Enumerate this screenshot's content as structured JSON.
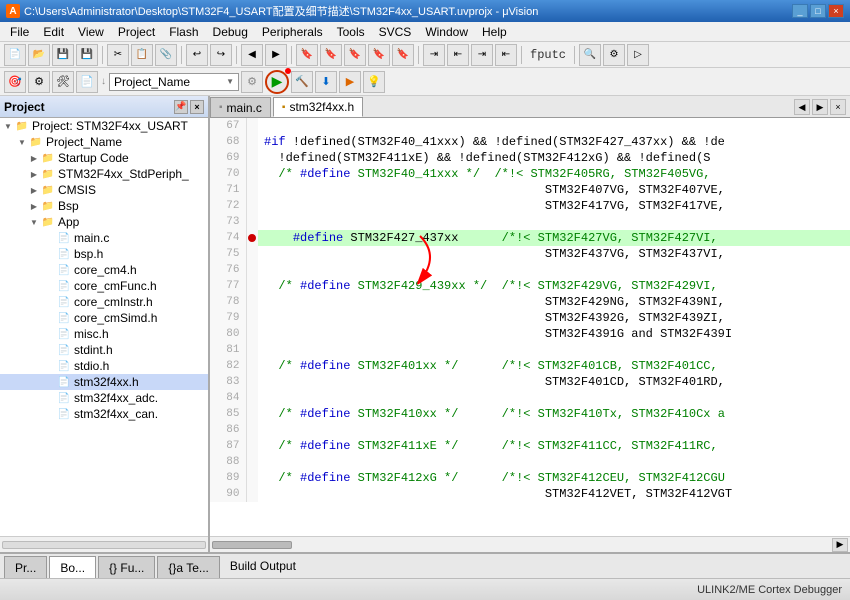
{
  "titleBar": {
    "icon": "A",
    "title": "C:\\Users\\Administrator\\Desktop\\STM32F4_USART配置及细节描述\\STM32F4xx_USART.uvprojx - μVision",
    "controls": [
      "_",
      "□",
      "×"
    ]
  },
  "menuBar": {
    "items": [
      "File",
      "Edit",
      "View",
      "Project",
      "Flash",
      "Debug",
      "Peripherals",
      "Tools",
      "SVCS",
      "Window",
      "Help"
    ]
  },
  "toolbar2": {
    "projectName": "Project_Name"
  },
  "sidebar": {
    "title": "Project",
    "root": "Project: STM32F4xx_USART",
    "projectName": "Project_Name",
    "items": [
      {
        "label": "Startup Code",
        "type": "folder",
        "level": 2
      },
      {
        "label": "STM32F4xx_StdPeriph_",
        "type": "folder",
        "level": 2
      },
      {
        "label": "CMSIS",
        "type": "folder",
        "level": 2
      },
      {
        "label": "Bsp",
        "type": "folder",
        "level": 2
      },
      {
        "label": "App",
        "type": "folder",
        "level": 2
      },
      {
        "label": "main.c",
        "type": "file",
        "level": 3
      },
      {
        "label": "bsp.h",
        "type": "file",
        "level": 4
      },
      {
        "label": "core_cm4.h",
        "type": "file",
        "level": 4
      },
      {
        "label": "core_cmFunc.h",
        "type": "file",
        "level": 4
      },
      {
        "label": "core_cmInstr.h",
        "type": "file",
        "level": 4
      },
      {
        "label": "core_cmSimd.h",
        "type": "file",
        "level": 4
      },
      {
        "label": "misc.h",
        "type": "file",
        "level": 4
      },
      {
        "label": "stdint.h",
        "type": "file",
        "level": 4
      },
      {
        "label": "stdio.h",
        "type": "file",
        "level": 4
      },
      {
        "label": "stm32f4xx.h",
        "type": "file",
        "level": 4,
        "selected": true
      },
      {
        "label": "stm32f4xx_adc.",
        "type": "file",
        "level": 4
      },
      {
        "label": "stm32f4xx_can.",
        "type": "file",
        "level": 4
      }
    ]
  },
  "tabs": [
    {
      "label": "main.c",
      "type": "c",
      "active": false
    },
    {
      "label": "stm32f4xx.h",
      "type": "h",
      "active": true
    }
  ],
  "codeLines": [
    {
      "num": 67,
      "content": "",
      "highlight": false,
      "bp": false
    },
    {
      "num": 68,
      "content": "#if !defined(STM32F40_41xxx) && !defined(STM32F427_437xx) && !de",
      "highlight": false,
      "bp": false
    },
    {
      "num": 69,
      "content": "  !defined(STM32F411xE) && !defined(STM32F412xG) && !defined(S",
      "highlight": false,
      "bp": false
    },
    {
      "num": 70,
      "content": "  /* #define STM32F40_41xxx */  /*!< STM32F405RG, STM32F405VG,",
      "highlight": false,
      "bp": false
    },
    {
      "num": 71,
      "content": "                                       STM32F407VG, STM32F407VE,",
      "highlight": false,
      "bp": false
    },
    {
      "num": 72,
      "content": "                                       STM32F417VG, STM32F417VE,",
      "highlight": false,
      "bp": false
    },
    {
      "num": 73,
      "content": "",
      "highlight": false,
      "bp": false
    },
    {
      "num": 74,
      "content": "    #define STM32F427_437xx      /*!< STM32F427VG, STM32F427VI,",
      "highlight": true,
      "bp": true
    },
    {
      "num": 75,
      "content": "                                       STM32F437VG, STM32F437VI,",
      "highlight": false,
      "bp": false
    },
    {
      "num": 76,
      "content": "",
      "highlight": false,
      "bp": false
    },
    {
      "num": 77,
      "content": "  /* #define STM32F429_439xx */  /*!< STM32F429VG, STM32F429VI,",
      "highlight": false,
      "bp": false
    },
    {
      "num": 78,
      "content": "                                       STM32F429NG, STM32F439NI,",
      "highlight": false,
      "bp": false
    },
    {
      "num": 79,
      "content": "                                       STM32F4392G, STM32F439ZI,",
      "highlight": false,
      "bp": false
    },
    {
      "num": 80,
      "content": "                                       STM32F4391G and STM32F439I",
      "highlight": false,
      "bp": false
    },
    {
      "num": 81,
      "content": "",
      "highlight": false,
      "bp": false
    },
    {
      "num": 82,
      "content": "  /* #define STM32F401xx */      /*!< STM32F401CB, STM32F401CC,",
      "highlight": false,
      "bp": false
    },
    {
      "num": 83,
      "content": "                                       STM32F401CD, STM32F401RD,",
      "highlight": false,
      "bp": false
    },
    {
      "num": 84,
      "content": "",
      "highlight": false,
      "bp": false
    },
    {
      "num": 85,
      "content": "  /* #define STM32F410xx */      /*!< STM32F410Tx, STM32F410Cx a",
      "highlight": false,
      "bp": false
    },
    {
      "num": 86,
      "content": "",
      "highlight": false,
      "bp": false
    },
    {
      "num": 87,
      "content": "  /* #define STM32F411xE */      /*!< STM32F411CC, STM32F411RC,",
      "highlight": false,
      "bp": false
    },
    {
      "num": 88,
      "content": "",
      "highlight": false,
      "bp": false
    },
    {
      "num": 89,
      "content": "  /* #define STM32F412xG */      /*!< STM32F412CEU, STM32F412CGU",
      "highlight": false,
      "bp": false
    },
    {
      "num": 90,
      "content": "                                       STM32F412VET, STM32F412VGT",
      "highlight": false,
      "bp": false
    }
  ],
  "bottomTabs": [
    {
      "label": "Pr...",
      "active": false
    },
    {
      "label": "Bo...",
      "active": true
    },
    {
      "label": "{} Fu...",
      "active": false
    },
    {
      "label": "{}a Te...",
      "active": false
    }
  ],
  "buildOutput": "Build Output",
  "statusBar": {
    "text": "ULINK2/ME Cortex Debugger"
  }
}
